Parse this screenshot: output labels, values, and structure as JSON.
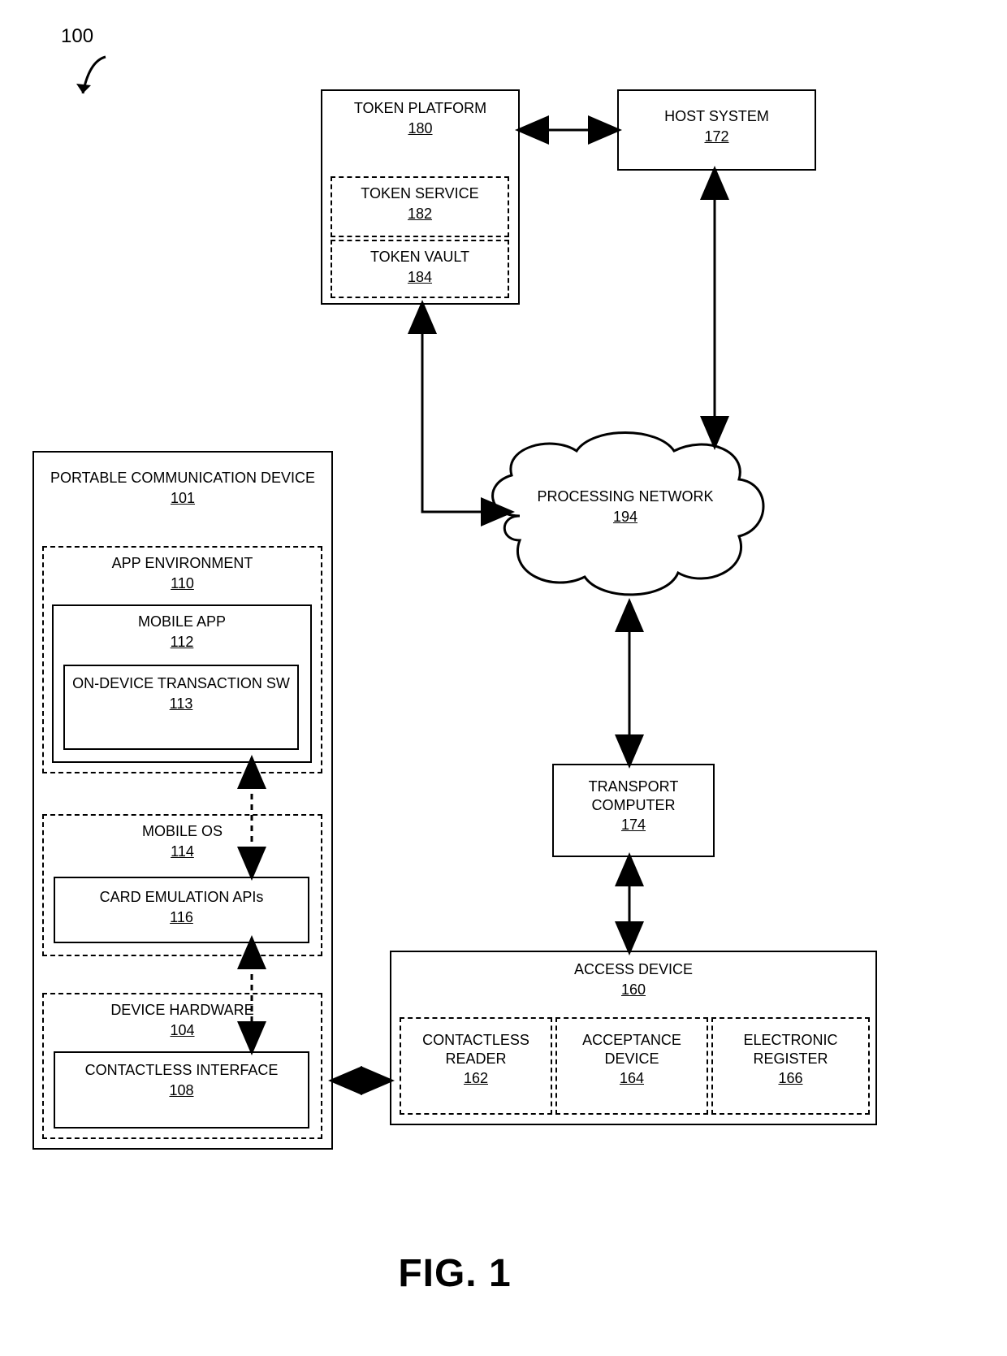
{
  "figure": {
    "number": "100",
    "caption": "FIG. 1"
  },
  "tokenPlatform": {
    "label": "TOKEN PLATFORM",
    "ref": "180",
    "tokenService": {
      "label": "TOKEN SERVICE",
      "ref": "182"
    },
    "tokenVault": {
      "label": "TOKEN VAULT",
      "ref": "184"
    }
  },
  "hostSystem": {
    "label": "HOST SYSTEM",
    "ref": "172"
  },
  "processingNetwork": {
    "label": "PROCESSING NETWORK",
    "ref": "194"
  },
  "transportComputer": {
    "label": "TRANSPORT COMPUTER",
    "ref": "174"
  },
  "accessDevice": {
    "label": "ACCESS DEVICE",
    "ref": "160",
    "contactlessReader": {
      "label": "CONTACTLESS READER",
      "ref": "162"
    },
    "acceptanceDevice": {
      "label": "ACCEPTANCE DEVICE",
      "ref": "164"
    },
    "electronicRegister": {
      "label": "ELECTRONIC REGISTER",
      "ref": "166"
    }
  },
  "device": {
    "label": "PORTABLE COMMUNICATION DEVICE",
    "ref": "101",
    "appEnv": {
      "label": "APP ENVIRONMENT",
      "ref": "110",
      "mobileApp": {
        "label": "MOBILE APP",
        "ref": "112",
        "onDeviceSw": {
          "label": "ON-DEVICE TRANSACTION SW",
          "ref": "113"
        }
      }
    },
    "mobileOs": {
      "label": "MOBILE OS",
      "ref": "114",
      "cardEmu": {
        "label": "CARD EMULATION APIs",
        "ref": "116"
      }
    },
    "hardware": {
      "label": "DEVICE HARDWARE",
      "ref": "104",
      "contactlessIf": {
        "label": "CONTACTLESS INTERFACE",
        "ref": "108"
      }
    }
  }
}
